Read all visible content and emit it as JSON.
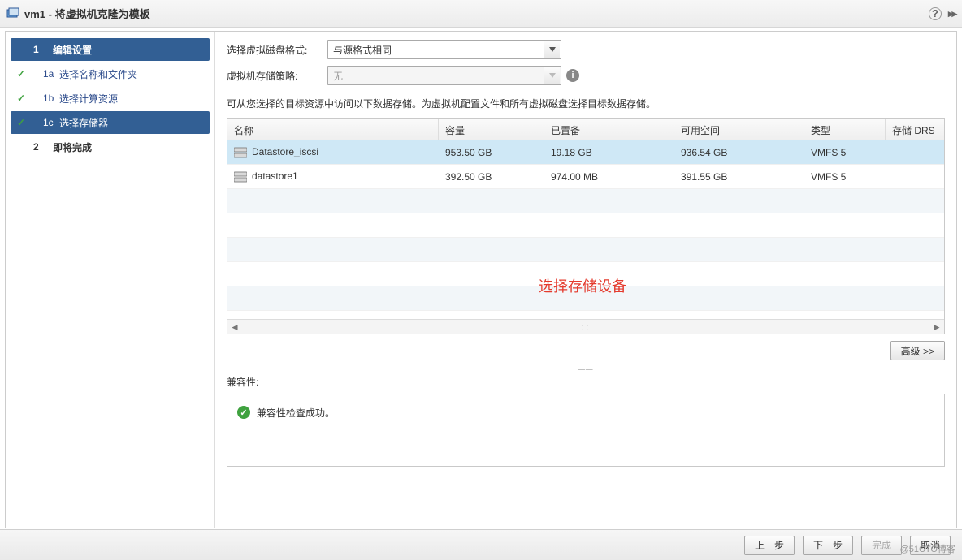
{
  "title": "vm1 - 将虚拟机克隆为模板",
  "sidebar": {
    "step1": {
      "num": "1",
      "label": "编辑设置"
    },
    "step1a": {
      "num": "1a",
      "label": "选择名称和文件夹"
    },
    "step1b": {
      "num": "1b",
      "label": "选择计算资源"
    },
    "step1c": {
      "num": "1c",
      "label": "选择存储器"
    },
    "step2": {
      "num": "2",
      "label": "即将完成"
    }
  },
  "form": {
    "disk_format_label": "选择虚拟磁盘格式:",
    "disk_format_value": "与源格式相同",
    "storage_policy_label": "虚拟机存储策略:",
    "storage_policy_value": "无"
  },
  "instruction": "可从您选择的目标资源中访问以下数据存储。为虚拟机配置文件和所有虚拟磁盘选择目标数据存储。",
  "table": {
    "headers": {
      "name": "名称",
      "capacity": "容量",
      "provisioned": "已置备",
      "free": "可用空间",
      "type": "类型",
      "drs": "存储 DRS"
    },
    "rows": [
      {
        "name": "Datastore_iscsi",
        "capacity": "953.50 GB",
        "provisioned": "19.18 GB",
        "free": "936.54 GB",
        "type": "VMFS 5",
        "drs": ""
      },
      {
        "name": "datastore1",
        "capacity": "392.50 GB",
        "provisioned": "974.00 MB",
        "free": "391.55 GB",
        "type": "VMFS 5",
        "drs": ""
      }
    ]
  },
  "annotation": "选择存储设备",
  "advanced_label": "高级 >>",
  "compat": {
    "label": "兼容性:",
    "message": "兼容性检查成功。"
  },
  "footer": {
    "back": "上一步",
    "next": "下一步",
    "finish": "完成",
    "cancel": "取消"
  },
  "watermark": "@51CTO博客"
}
